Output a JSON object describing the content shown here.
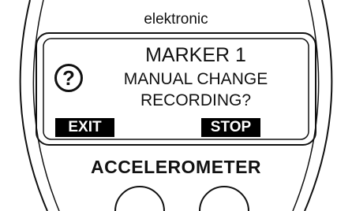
{
  "device": {
    "brand": "elektronic",
    "name": "ACCELEROMETER"
  },
  "screen": {
    "icon": "question-mark-icon",
    "icon_glyph": "?",
    "title": "MARKER 1",
    "message_line1": "MANUAL CHANGE",
    "message_line2": "RECORDING?"
  },
  "softkeys": {
    "left_label": "EXIT",
    "right_label": "STOP"
  },
  "colors": {
    "outline": "#111111",
    "softkey_bg": "#000000",
    "softkey_text": "#ffffff",
    "background": "#ffffff"
  }
}
